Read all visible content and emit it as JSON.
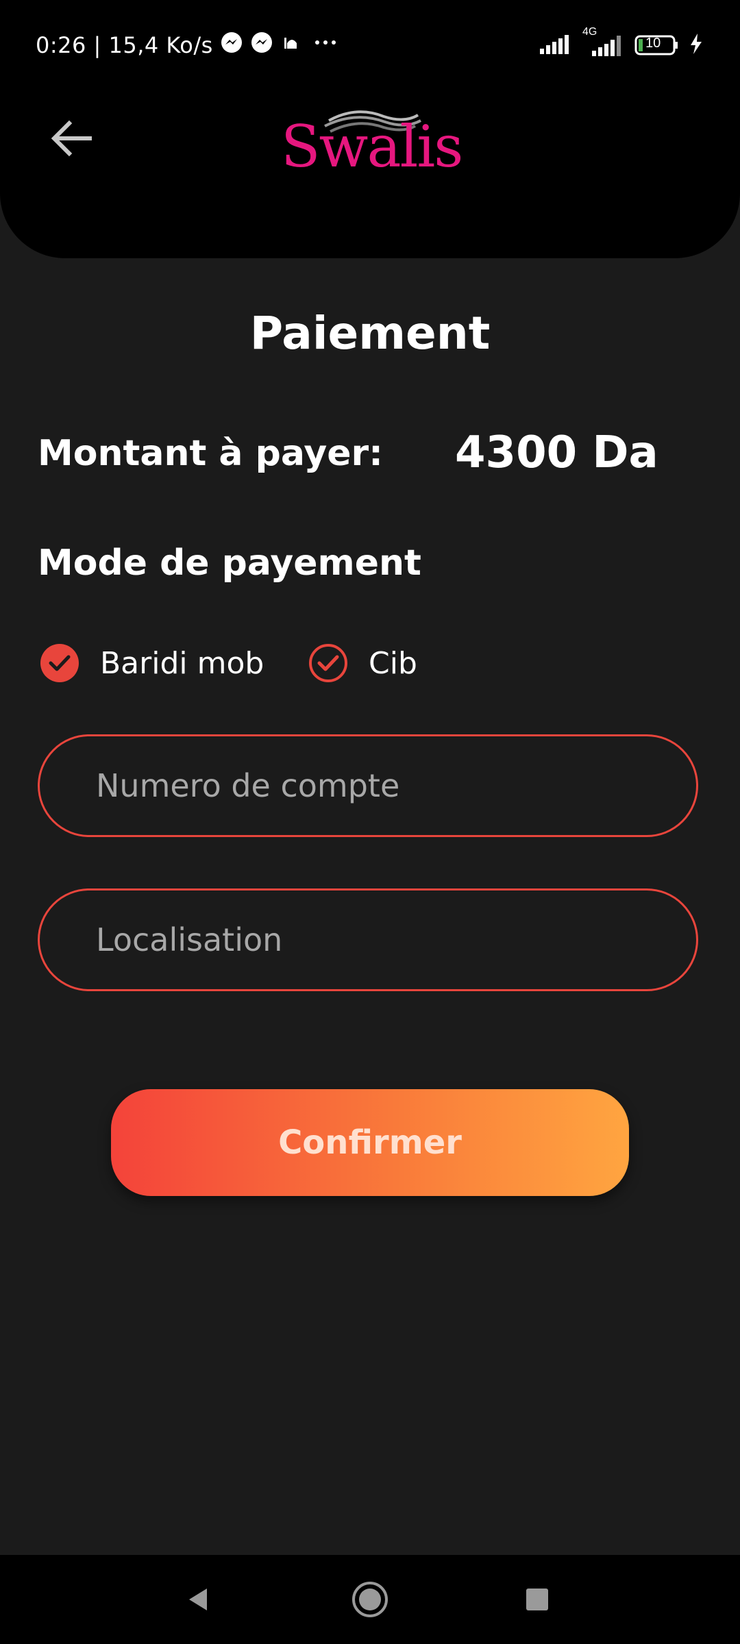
{
  "status_bar": {
    "time_speed": "0:26 | 15,4 Ko/s",
    "network": "4G",
    "battery": "10"
  },
  "header": {
    "logo_text": "Swalis",
    "logo_color": "#e6177f"
  },
  "page": {
    "title": "Paiement",
    "amount_label": "Montant à payer:",
    "amount_value": "4300 Da",
    "mode_label": "Mode de payement"
  },
  "payment_options": [
    {
      "label": "Baridi mob",
      "checked": true
    },
    {
      "label": "Cib",
      "checked": true
    }
  ],
  "form": {
    "account_placeholder": "Numero de compte",
    "account_value": "",
    "location_placeholder": "Localisation",
    "location_value": ""
  },
  "actions": {
    "confirm_label": "Confirmer"
  },
  "theme": {
    "accent": "#e8453c",
    "gradient_start": "#f4433a",
    "gradient_end": "#ffa540",
    "background": "#1b1b1b"
  }
}
